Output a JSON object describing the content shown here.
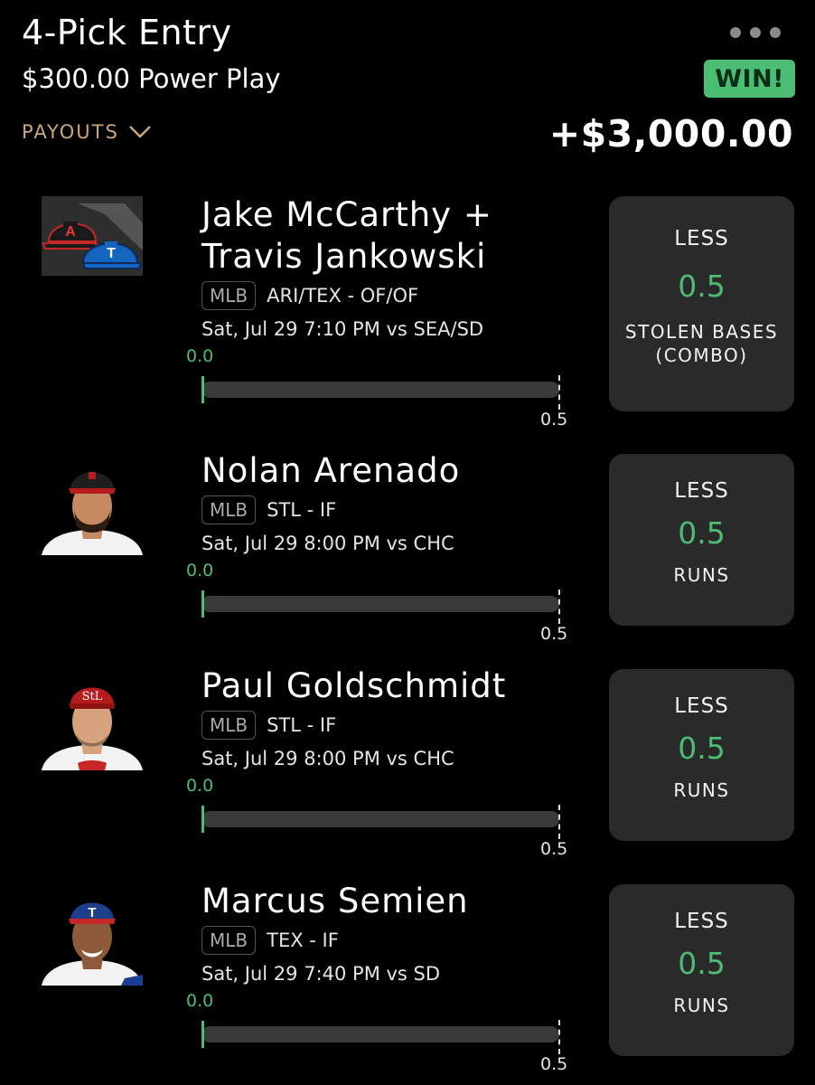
{
  "entry": {
    "title": "4-Pick Entry",
    "subtitle": "$300.00 Power Play",
    "payouts_label": "PAYOUTS",
    "status_badge": "WIN!",
    "payout_amount": "+$3,000.00"
  },
  "colors": {
    "accent_green": "#4dbd74",
    "payouts_gold": "#c9a77c",
    "card_bg": "#2a2a2a"
  },
  "picks": [
    {
      "name_line1": "Jake McCarthy +",
      "name_line2": "Travis Jankowski",
      "league": "MLB",
      "team_pos": "ARI/TEX - OF/OF",
      "game": "Sat, Jul 29 7:10 PM  vs SEA/SD",
      "actual": "0.0",
      "target": "0.5",
      "progress": 0,
      "direction": "LESS",
      "line": "0.5",
      "stat_line1": "STOLEN BASES",
      "stat_line2": "(COMBO)",
      "avatar_icon": "team-caps-icon"
    },
    {
      "name_line1": "Nolan Arenado",
      "league": "MLB",
      "team_pos": "STL - IF",
      "game": "Sat, Jul 29 8:00 PM  vs CHC",
      "actual": "0.0",
      "target": "0.5",
      "progress": 0,
      "direction": "LESS",
      "line": "0.5",
      "stat_line1": "RUNS",
      "avatar_icon": "player-headshot-icon"
    },
    {
      "name_line1": "Paul Goldschmidt",
      "league": "MLB",
      "team_pos": "STL - IF",
      "game": "Sat, Jul 29 8:00 PM  vs CHC",
      "actual": "0.0",
      "target": "0.5",
      "progress": 0,
      "direction": "LESS",
      "line": "0.5",
      "stat_line1": "RUNS",
      "avatar_icon": "player-headshot-icon"
    },
    {
      "name_line1": "Marcus Semien",
      "league": "MLB",
      "team_pos": "TEX - IF",
      "game": "Sat, Jul 29 7:40 PM  vs SD",
      "actual": "0.0",
      "target": "0.5",
      "progress": 0,
      "direction": "LESS",
      "line": "0.5",
      "stat_line1": "RUNS",
      "avatar_icon": "player-headshot-icon"
    }
  ]
}
